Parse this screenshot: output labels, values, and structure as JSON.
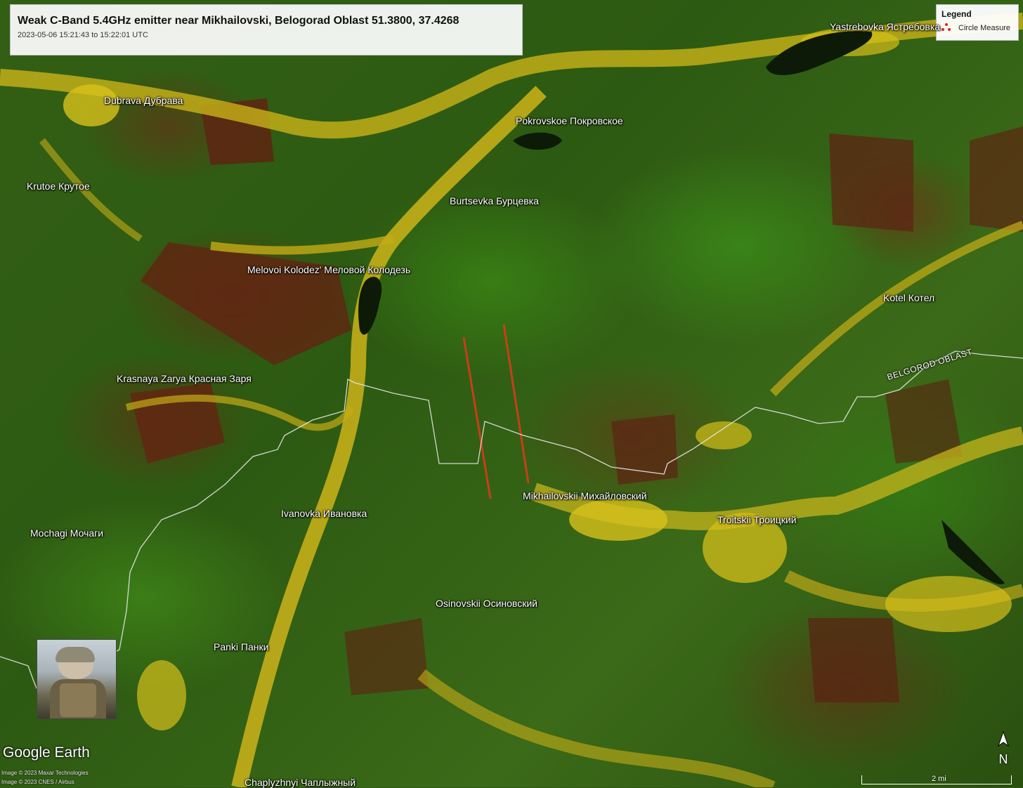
{
  "title": "Weak C-Band 5.4GHz emitter near Mikhailovski, Belogorad Oblast 51.3800, 37.4268",
  "subtitle": "2023-05-06 15:21:43 to 15:22:01 UTC",
  "legend": {
    "title": "Legend",
    "item": "Circle Measure",
    "icon": "circle-measure-icon",
    "icon_color": "#d22222"
  },
  "places": [
    "Yastrebovka Ястребовка",
    "Dubrava Дубрава",
    "Pokrovskoe Покровское",
    "Krutoe Крутое",
    "Burtsevka Бурцевка",
    "Melovoi Kolodez' Меловой Колодезь",
    "Kotel Котел",
    "Krasnaya Zarya Красная Заря",
    "Mikhailovskii Михайловский",
    "Ivanovka Ивановка",
    "Troitskii Троицкий",
    "Mochagi Мочаги",
    "Osinovskii Осиновский",
    "Panki Панки",
    "Chaplyzhnyi Чаплыжный"
  ],
  "region_label": "BELGOROD OBLAST",
  "branding": "Google Earth",
  "credits": [
    "Image © 2023 Maxar Technologies",
    "Image © 2023 CNES / Airbus"
  ],
  "north_label": "N",
  "scale_label": "2 mi",
  "colors": {
    "field_green": "#3f7a1a",
    "field_yellow": "#d8c21a",
    "field_brown": "#6b2a14",
    "emitter_streak": "#e03a1a",
    "border_line": "#e6e6e6"
  }
}
